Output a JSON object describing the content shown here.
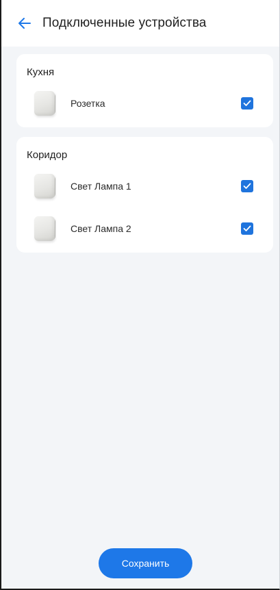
{
  "header": {
    "title": "Подключенные устройства",
    "back_icon": "arrow-left-icon"
  },
  "colors": {
    "accent": "#1e78e8",
    "checkbox": "#1f74dd",
    "background": "#f3f5f8",
    "card": "#ffffff"
  },
  "groups": [
    {
      "title": "Кухня",
      "devices": [
        {
          "name": "Розетка",
          "checked": true
        }
      ]
    },
    {
      "title": "Коридор",
      "devices": [
        {
          "name": "Свет Лампа 1",
          "checked": true
        },
        {
          "name": "Свет Лампа 2",
          "checked": true
        }
      ]
    }
  ],
  "footer": {
    "save_label": "Сохранить"
  }
}
